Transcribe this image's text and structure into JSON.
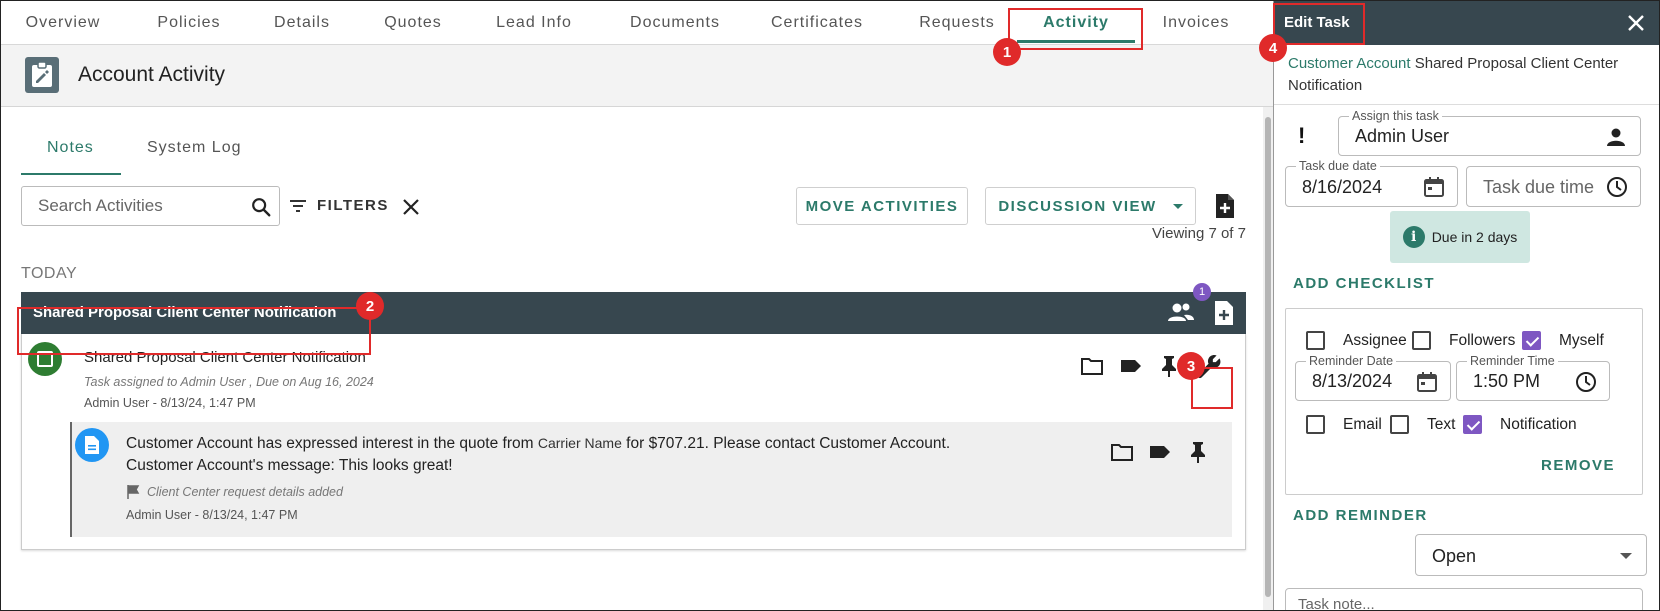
{
  "top_tabs": [
    {
      "label": "Overview"
    },
    {
      "label": "Policies"
    },
    {
      "label": "Details"
    },
    {
      "label": "Quotes"
    },
    {
      "label": "Lead Info"
    },
    {
      "label": "Documents"
    },
    {
      "label": "Certificates"
    },
    {
      "label": "Requests"
    },
    {
      "label": "Activity",
      "active": true
    },
    {
      "label": "Invoices"
    }
  ],
  "page": {
    "title": "Account Activity",
    "icon": "clipboard-edit-icon"
  },
  "subtabs": {
    "notes": "Notes",
    "system_log": "System Log"
  },
  "toolbar": {
    "search_placeholder": "Search Activities",
    "filters_label": "FILTERS",
    "move_activities_label": "MOVE ACTIVITIES",
    "discussion_view_label": "DISCUSSION VIEW",
    "viewing_text": "Viewing 7 of 7"
  },
  "group": {
    "date_label": "TODAY",
    "title": "Shared Proposal Client Center Notification",
    "followers_count": "1"
  },
  "task": {
    "title": "Shared Proposal Client Center Notification",
    "assigned_text": "Task assigned to Admin User , Due on Aug 16, 2024",
    "meta": "Admin User - 8/13/24, 1:47 PM"
  },
  "subnote": {
    "line1_before": "Customer Account has expressed interest in the quote from",
    "carrier": "Carrier Name",
    "line1_after": "for $707.21. Please contact Customer Account.",
    "line2": "Customer Account's message: This looks great!",
    "flag_text": "Client Center request details added",
    "meta": "Admin User - 8/13/24, 1:47 PM"
  },
  "panel": {
    "title": "Edit Task",
    "breadcrumb_link": "Customer Account",
    "breadcrumb_rest": "Shared Proposal Client Center Notification",
    "assign_label": "Assign this task",
    "assign_value": "Admin User",
    "due_date_label": "Task due date",
    "due_date_value": "8/16/2024",
    "due_time_placeholder": "Task due time",
    "due_info": "Due in 2 days",
    "add_checklist": "ADD CHECKLIST",
    "reminder": {
      "assignee": "Assignee",
      "followers": "Followers",
      "myself": "Myself",
      "date_label": "Reminder Date",
      "date_value": "8/13/2024",
      "time_label": "Reminder Time",
      "time_value": "1:50 PM",
      "email": "Email",
      "text": "Text",
      "notification": "Notification",
      "remove": "REMOVE",
      "checked": {
        "assignee": false,
        "followers": false,
        "myself": true,
        "email": false,
        "text": false,
        "notification": true
      }
    },
    "add_reminder": "ADD REMINDER",
    "status_value": "Open",
    "task_note_placeholder": "Task note..."
  },
  "annotations": [
    "1",
    "2",
    "3",
    "4"
  ],
  "colors": {
    "accent": "#2c7a6a",
    "header_dark": "#37474f",
    "annotation_red": "#e02a2a",
    "checkbox_purple": "#7e57c2"
  }
}
